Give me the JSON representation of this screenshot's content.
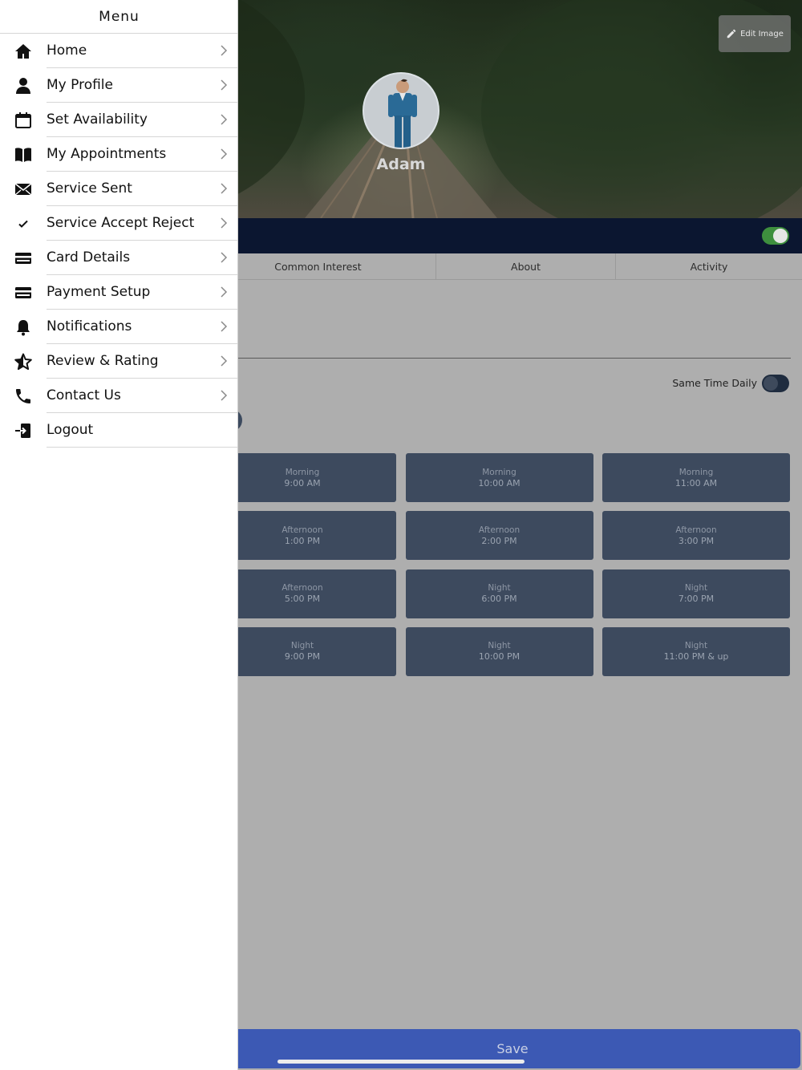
{
  "drawer": {
    "title": "Menu",
    "items": [
      {
        "label": "Home",
        "icon": "home-icon",
        "chevron": true
      },
      {
        "label": "My Profile",
        "icon": "user-icon",
        "chevron": true
      },
      {
        "label": "Set Availability",
        "icon": "calendar-icon",
        "chevron": true
      },
      {
        "label": "My Appointments",
        "icon": "book-icon",
        "chevron": true
      },
      {
        "label": "Service Sent",
        "icon": "envelope-icon",
        "chevron": true
      },
      {
        "label": "Service Accept Reject",
        "icon": "checkmark-icon",
        "chevron": true
      },
      {
        "label": "Card Details",
        "icon": "credit-card-icon",
        "chevron": true
      },
      {
        "label": "Payment Setup",
        "icon": "payment-card-icon",
        "chevron": true
      },
      {
        "label": "Notifications",
        "icon": "bell-icon",
        "chevron": true
      },
      {
        "label": "Review & Rating",
        "icon": "star-icon",
        "chevron": true
      },
      {
        "label": "Contact Us",
        "icon": "phone-icon",
        "chevron": true
      },
      {
        "label": "Logout",
        "icon": "logout-icon",
        "chevron": false
      }
    ]
  },
  "header": {
    "edit_image_label": "Edit Image",
    "profile_name": "Adam",
    "online_toggle_on": true
  },
  "tabs": [
    {
      "label": "Common Interest"
    },
    {
      "label": "About"
    },
    {
      "label": "Activity"
    }
  ],
  "availability": {
    "same_time_daily_label": "Same Time Daily",
    "same_time_daily_on": false,
    "slots": [
      {
        "period": "Morning",
        "time": "9:00 AM"
      },
      {
        "period": "Morning",
        "time": "10:00 AM"
      },
      {
        "period": "Morning",
        "time": "11:00 AM"
      },
      {
        "period": "Afternoon",
        "time": "1:00 PM"
      },
      {
        "period": "Afternoon",
        "time": "2:00 PM"
      },
      {
        "period": "Afternoon",
        "time": "3:00 PM"
      },
      {
        "period": "Afternoon",
        "time": "5:00 PM"
      },
      {
        "period": "Night",
        "time": "6:00 PM"
      },
      {
        "period": "Night",
        "time": "7:00 PM"
      },
      {
        "period": "Night",
        "time": "9:00 PM"
      },
      {
        "period": "Night",
        "time": "10:00 PM"
      },
      {
        "period": "Night",
        "time": "11:00 PM & up"
      }
    ]
  },
  "footer": {
    "save_label": "Save"
  },
  "colors": {
    "nav_bar": "#0b1630",
    "slot_bg": "#3d4a5e",
    "save_bg": "#3c59b4",
    "toggle_on": "#3e8f3e"
  }
}
